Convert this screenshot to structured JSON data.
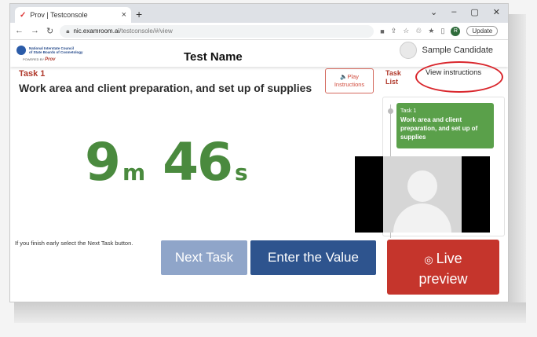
{
  "browser": {
    "tab_title": "Prov | Testconsole",
    "tab_favicon": "check-icon",
    "tab_close": "×",
    "new_tab": "+",
    "window_controls": [
      "⌄",
      "–",
      "▢",
      "✕"
    ],
    "url_host": "nic.examroom.ai",
    "url_path": "/testconsole/#/view",
    "profile_initial": "R",
    "update_label": "Update"
  },
  "header": {
    "logo_line1": "National Interstate Council",
    "logo_line2": "of State Boards of Cosmetology",
    "logo_powered": "POWERED BY",
    "logo_brand": "Prov",
    "test_name": "Test Name",
    "candidate": "Sample Candidate"
  },
  "task": {
    "label": "Task 1",
    "title": "Work area and client preparation, and set up of supplies",
    "play_icon": "speaker-icon",
    "play_line1": "🔈Play",
    "play_line2": "Instructions"
  },
  "timer": {
    "minutes": "9",
    "minutes_unit": "m",
    "seconds": "46",
    "seconds_unit": "s",
    "color": "#4a8a3e"
  },
  "task_list": {
    "heading_line1": "Task",
    "heading_line2": "List",
    "view_instructions": "View instructions",
    "items": [
      {
        "number": "Task 1",
        "name": "Work area and client preparation, and set up of supplies"
      }
    ]
  },
  "footer": {
    "finish_note": "If you finish early select the Next Task button.",
    "next_task": "Next Task",
    "enter_value": "Enter the Value",
    "live_preview_line1": "Live",
    "live_preview_line2": "preview",
    "live_icon": "eye-slash-icon"
  },
  "colors": {
    "accent_red": "#c5352c",
    "task_green": "#5aa04a",
    "primary_blue": "#2e548e",
    "disabled_blue": "#8fa5c9"
  }
}
